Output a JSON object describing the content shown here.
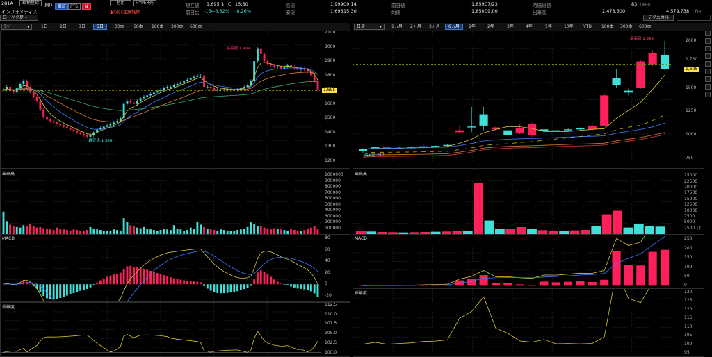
{
  "header": {
    "code": "281A",
    "name": "インフォメティス",
    "market": "東G",
    "buttons": {
      "watchlist": "銘柄登録",
      "tosho": "東証",
      "pts": "PTS",
      "n": "N",
      "credit": "信用",
      "hyper": "HYPER売"
    },
    "warning": "取引注意銘柄",
    "rows": [
      [
        {
          "label": "現在値",
          "value": "1,695 ↓",
          "extra": "C",
          "time": "15:30"
        },
        {
          "label": "高値",
          "value": "1,999",
          "time": "09:14"
        },
        {
          "label": "前日値",
          "value": "1,859",
          "time": "07/23"
        },
        {
          "label": "時価総額",
          "value": "83",
          "unit": "(億円)"
        }
      ],
      [
        {
          "label": "前日比",
          "value": "-164",
          "pct1": "-8.82%",
          "pct2": "-8.26%"
        },
        {
          "label": "安値",
          "value": "1,695",
          "time": "15:30"
        },
        {
          "label": "始値",
          "value": "1,850",
          "time": "09:00"
        },
        {
          "label": "出来高",
          "value": "2,478,600",
          "extra": "4,579,738",
          "unit": "(千円)"
        }
      ]
    ],
    "chart_type": "ローソク足",
    "technical": "テクニカル"
  },
  "left_toolbar": {
    "interval": "5分",
    "ranges": [
      "1日",
      "2日",
      "3日",
      "5日",
      "30本",
      "60本",
      "100本",
      "300本",
      "600本"
    ],
    "active": "5日"
  },
  "right_toolbar": {
    "interval": "日足",
    "ranges": [
      "1ヵ月",
      "2ヵ月",
      "3ヵ月",
      "6ヵ月",
      "1年",
      "2年",
      "3年",
      "4年",
      "5年",
      "10年",
      "YTD",
      "100本",
      "300本",
      "600本"
    ],
    "active": "6ヵ月"
  },
  "panels": {
    "volume": "出来高",
    "macd": "MACD",
    "deviation": "乖離度"
  },
  "annotations": {
    "high_left": "最高値:1,999",
    "low_left": "最安値:1,356",
    "high_right": "最高値:1,999",
    "low_right": "最安値:812"
  },
  "current_price": "1,695",
  "right_last_label": "1,750",
  "left_axes": {
    "price": [
      "2100",
      "2000",
      "1900",
      "1800",
      "1700",
      "1600",
      "1500",
      "1400",
      "1300",
      "1200"
    ],
    "volume": [
      "1000000",
      "900000",
      "800000",
      "700000",
      "600000",
      "500000",
      "400000",
      "300000",
      "200000",
      "100000"
    ],
    "macd": [
      "80",
      "60",
      "40",
      "20",
      "0",
      "-20"
    ],
    "dev": [
      "112.5",
      "110.0",
      "107.5",
      "105.0",
      "102.5",
      "100.0"
    ]
  },
  "right_axes": {
    "price": [
      "2000",
      "1500",
      "1250",
      "1000",
      "750"
    ],
    "volume": [
      "25000",
      "22500",
      "20000",
      "17500",
      "15000",
      "12500",
      "10000",
      "7500",
      "5000",
      "2500"
    ],
    "volume_unit": "(K)",
    "macd": [
      "250",
      "200",
      "150",
      "100",
      "50",
      "0"
    ],
    "dev": [
      "130",
      "125",
      "120",
      "115",
      "110",
      "105",
      "100",
      "95"
    ]
  },
  "colors": {
    "up": "#3ee0d8",
    "down": "#ff1f5a",
    "ma_yellow": "#d8c833",
    "ma_blue": "#3b7cff",
    "ma_orange": "#e07a2a",
    "ma_green": "#2fae6a",
    "price_tag": "#ffe23a"
  },
  "chart_data": [
    {
      "type": "candlestick",
      "timeframe": "5分",
      "ylim": [
        1150,
        2110
      ],
      "closes": [
        1700,
        1720,
        1690,
        1680,
        1710,
        1740,
        1760,
        1720,
        1680,
        1650,
        1620,
        1560,
        1510,
        1490,
        1480,
        1470,
        1460,
        1450,
        1440,
        1430,
        1420,
        1410,
        1400,
        1390,
        1380,
        1370,
        1380,
        1400,
        1420,
        1430,
        1440,
        1450,
        1460,
        1470,
        1480,
        1500,
        1600,
        1620,
        1610,
        1600,
        1620,
        1640,
        1650,
        1660,
        1670,
        1680,
        1690,
        1700,
        1710,
        1720,
        1720,
        1730,
        1740,
        1750,
        1760,
        1770,
        1780,
        1790,
        1800,
        1800,
        1720,
        1720,
        1710,
        1700,
        1700,
        1700,
        1700,
        1700,
        1700,
        1700,
        1700,
        1710,
        1720,
        1730,
        1760,
        1900,
        1990,
        1950,
        1900,
        1880,
        1870,
        1860,
        1860,
        1850,
        1860,
        1870,
        1860,
        1850,
        1840,
        1850,
        1840,
        1830,
        1800,
        1760,
        1695
      ],
      "volume": [
        380000,
        220000,
        160000,
        140000,
        120000,
        110000,
        150000,
        130000,
        170000,
        140000,
        110000,
        120000,
        100000,
        90000,
        80000,
        70000,
        110000,
        90000,
        80000,
        70000,
        60000,
        80000,
        70000,
        50000,
        60000,
        70000,
        120000,
        90000,
        80000,
        70000,
        60000,
        50000,
        60000,
        80000,
        70000,
        60000,
        270000,
        200000,
        150000,
        130000,
        110000,
        100000,
        120000,
        90000,
        80000,
        70000,
        60000,
        70000,
        90000,
        80000,
        70000,
        150000,
        90000,
        80000,
        60000,
        70000,
        110000,
        90000,
        210000,
        160000,
        120000,
        90000,
        80000,
        70000,
        60000,
        80000,
        70000,
        60000,
        50000,
        60000,
        70000,
        80000,
        90000,
        120000,
        200000,
        170000,
        140000,
        130000,
        110000,
        90000,
        80000,
        100000,
        90000,
        80000,
        70000,
        60000,
        80000,
        70000,
        60000,
        50000,
        70000,
        90000,
        110000,
        130000,
        80000
      ],
      "macd_axis": [
        -30,
        85
      ],
      "dev_axis": [
        99,
        113
      ]
    },
    {
      "type": "candlestick",
      "timeframe": "日足",
      "ylim": [
        650,
        2100
      ],
      "candles": [
        {
          "o": 830,
          "h": 860,
          "l": 812,
          "c": 850
        },
        {
          "o": 850,
          "h": 880,
          "l": 840,
          "c": 870
        },
        {
          "o": 870,
          "h": 885,
          "l": 850,
          "c": 860
        },
        {
          "o": 860,
          "h": 880,
          "l": 850,
          "c": 865
        },
        {
          "o": 865,
          "h": 880,
          "l": 855,
          "c": 870
        },
        {
          "o": 870,
          "h": 900,
          "l": 860,
          "c": 880
        },
        {
          "o": 880,
          "h": 890,
          "l": 870,
          "c": 885
        },
        {
          "o": 885,
          "h": 900,
          "l": 880,
          "c": 895
        },
        {
          "o": 1050,
          "h": 1100,
          "l": 1020,
          "c": 1030
        },
        {
          "o": 1080,
          "h": 1300,
          "l": 1030,
          "c": 1090
        },
        {
          "o": 1100,
          "h": 1300,
          "l": 1050,
          "c": 1220
        },
        {
          "o": 1080,
          "h": 1100,
          "l": 1040,
          "c": 1060
        },
        {
          "o": 1000,
          "h": 1060,
          "l": 980,
          "c": 1050
        },
        {
          "o": 1070,
          "h": 1120,
          "l": 1010,
          "c": 1020
        },
        {
          "o": 1120,
          "h": 1130,
          "l": 980,
          "c": 1000
        },
        {
          "o": 1040,
          "h": 1070,
          "l": 1020,
          "c": 1060
        },
        {
          "o": 1040,
          "h": 1060,
          "l": 1030,
          "c": 1050
        },
        {
          "o": 1050,
          "h": 1070,
          "l": 1040,
          "c": 1060
        },
        {
          "o": 1060,
          "h": 1080,
          "l": 1050,
          "c": 1070
        },
        {
          "o": 1100,
          "h": 1130,
          "l": 1030,
          "c": 1060
        },
        {
          "o": 1420,
          "h": 1440,
          "l": 1090,
          "c": 1100
        },
        {
          "o": 1530,
          "h": 1700,
          "l": 1500,
          "c": 1600
        },
        {
          "o": 1450,
          "h": 1500,
          "l": 1420,
          "c": 1470
        },
        {
          "o": 1780,
          "h": 1800,
          "l": 1490,
          "c": 1500
        },
        {
          "o": 1870,
          "h": 1900,
          "l": 1730,
          "c": 1750
        },
        {
          "o": 1700,
          "h": 1999,
          "l": 1690,
          "c": 1850
        }
      ],
      "volume_k": [
        1200,
        1100,
        900,
        800,
        700,
        800,
        900,
        1000,
        1100,
        1300,
        1200,
        22000,
        5800,
        2400,
        2100,
        3000,
        2200,
        1700,
        1500,
        1400,
        1600,
        1800,
        3600,
        8500,
        10000,
        2800,
        4300,
        3500,
        3200
      ],
      "macd_axis": [
        -10,
        270
      ],
      "dev_axis": [
        93,
        132
      ]
    }
  ]
}
